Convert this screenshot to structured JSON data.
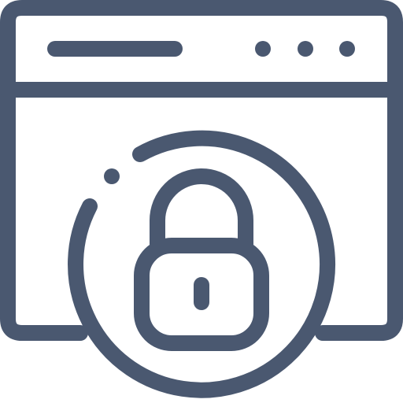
{
  "icon": {
    "name": "secure-browser-lock-icon",
    "stroke_color": "#4a5870",
    "background_color": "#ffffff"
  }
}
